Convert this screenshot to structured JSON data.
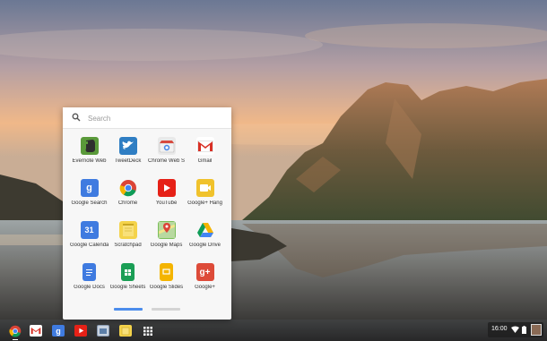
{
  "search": {
    "placeholder": "Search"
  },
  "apps": [
    {
      "label": "Evernote Web",
      "icon": "evernote-icon",
      "color": "#5a9a3a"
    },
    {
      "label": "TweetDeck",
      "icon": "tweetdeck-icon",
      "color": "#2f7ec3"
    },
    {
      "label": "Chrome Web S",
      "icon": "chrome-web-store-icon",
      "color": "#e9e9e9"
    },
    {
      "label": "Gmail",
      "icon": "gmail-icon",
      "color": "#ffffff"
    },
    {
      "label": "Google Search",
      "icon": "google-search-icon",
      "color": "#3f7be0"
    },
    {
      "label": "Chrome",
      "icon": "chrome-icon",
      "color": "#ffffff"
    },
    {
      "label": "YouTube",
      "icon": "youtube-icon",
      "color": "#e62117"
    },
    {
      "label": "Google+ Hang",
      "icon": "hangouts-icon",
      "color": "#f0c22c"
    },
    {
      "label": "Google Calenda",
      "icon": "calendar-icon",
      "color": "#3f7be0"
    },
    {
      "label": "Scratchpad",
      "icon": "scratchpad-icon",
      "color": "#f4d34b"
    },
    {
      "label": "Google Maps",
      "icon": "maps-icon",
      "color": "#7cbf5b"
    },
    {
      "label": "Google Drive",
      "icon": "drive-icon",
      "color": "#ffffff"
    },
    {
      "label": "Google Docs",
      "icon": "docs-icon",
      "color": "#3f7be0"
    },
    {
      "label": "Google Sheets",
      "icon": "sheets-icon",
      "color": "#1a9e55"
    },
    {
      "label": "Google Slides",
      "icon": "slides-icon",
      "color": "#f4b400"
    },
    {
      "label": "Google+",
      "icon": "google-plus-icon",
      "color": "#dd4b39"
    }
  ],
  "shelf": {
    "items": [
      "chrome-icon",
      "gmail-icon",
      "google-search-icon",
      "youtube-icon",
      "files-icon",
      "scratchpad-icon",
      "app-launcher-icon"
    ]
  },
  "status": {
    "time": "16:00",
    "icons": [
      "wifi-icon",
      "battery-icon",
      "avatar"
    ]
  },
  "pager": {
    "pages": 2,
    "current": 1
  }
}
